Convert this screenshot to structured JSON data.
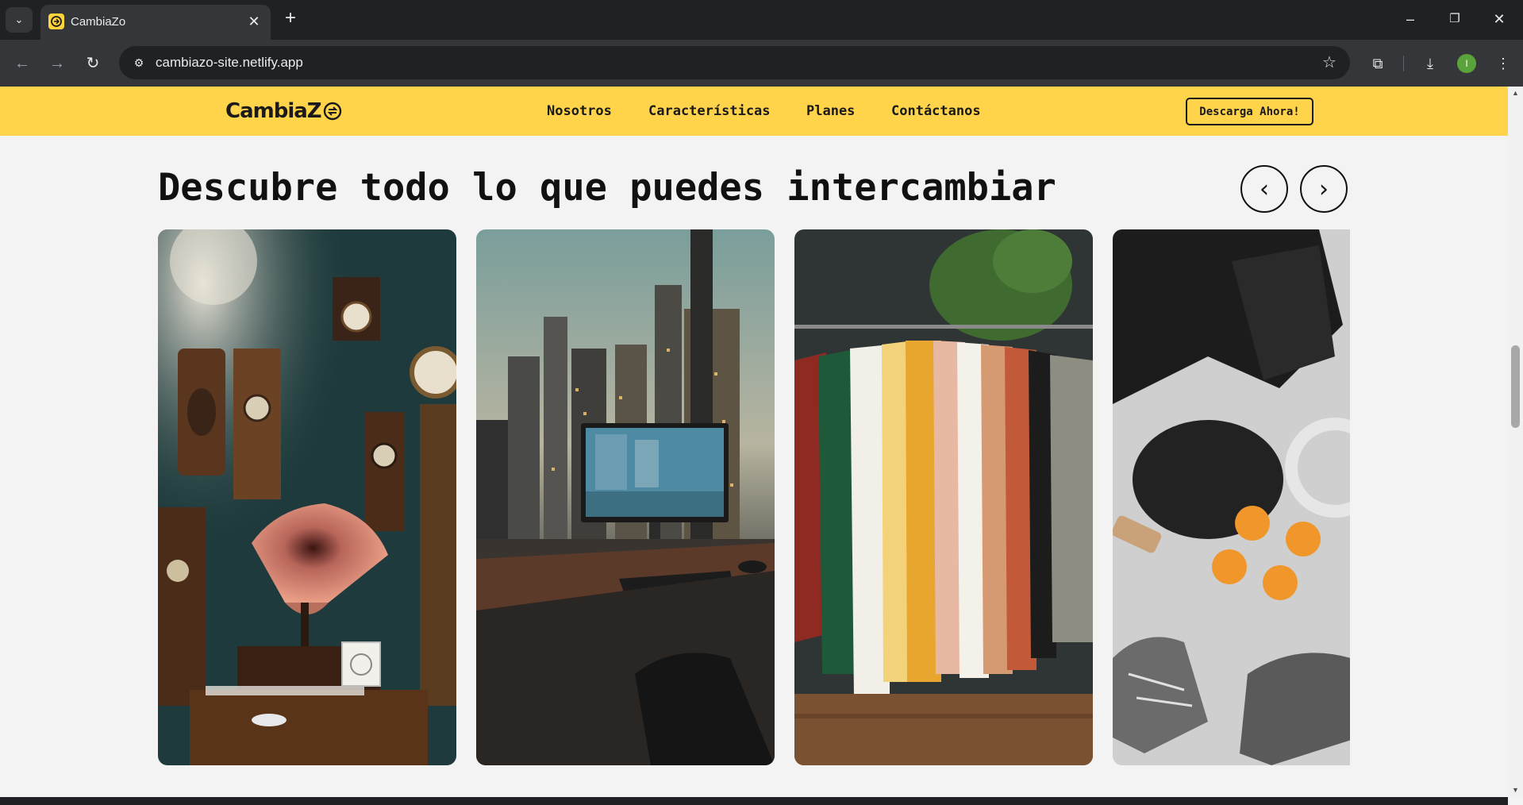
{
  "browser": {
    "tab_title": "CambiaZo",
    "url": "cambiazo-site.netlify.app",
    "profile_initial": "I"
  },
  "site": {
    "logo_text": "CambiaZ",
    "brand_color": "#ffd44a",
    "nav": [
      "Nosotros",
      "Características",
      "Planes",
      "Contáctanos"
    ],
    "cta_label": "Descarga Ahora!"
  },
  "carousel": {
    "title": "Descubre todo lo que puedes intercambiar",
    "prev_label": "‹",
    "next_label": "›",
    "cards": [
      {
        "subject": "antique-clocks-gramophone"
      },
      {
        "subject": "desk-computer-city-view"
      },
      {
        "subject": "clothes-rack-shirts"
      },
      {
        "subject": "sports-gear-flatlay"
      }
    ]
  },
  "icons": [
    "tab-search-icon",
    "favicon-icon",
    "close-icon",
    "plus-icon",
    "minimize-icon",
    "restore-icon",
    "window-close-icon",
    "back-icon",
    "forward-icon",
    "reload-icon",
    "site-settings-icon",
    "star-icon",
    "extensions-icon",
    "download-icon",
    "menu-kebab-icon"
  ]
}
